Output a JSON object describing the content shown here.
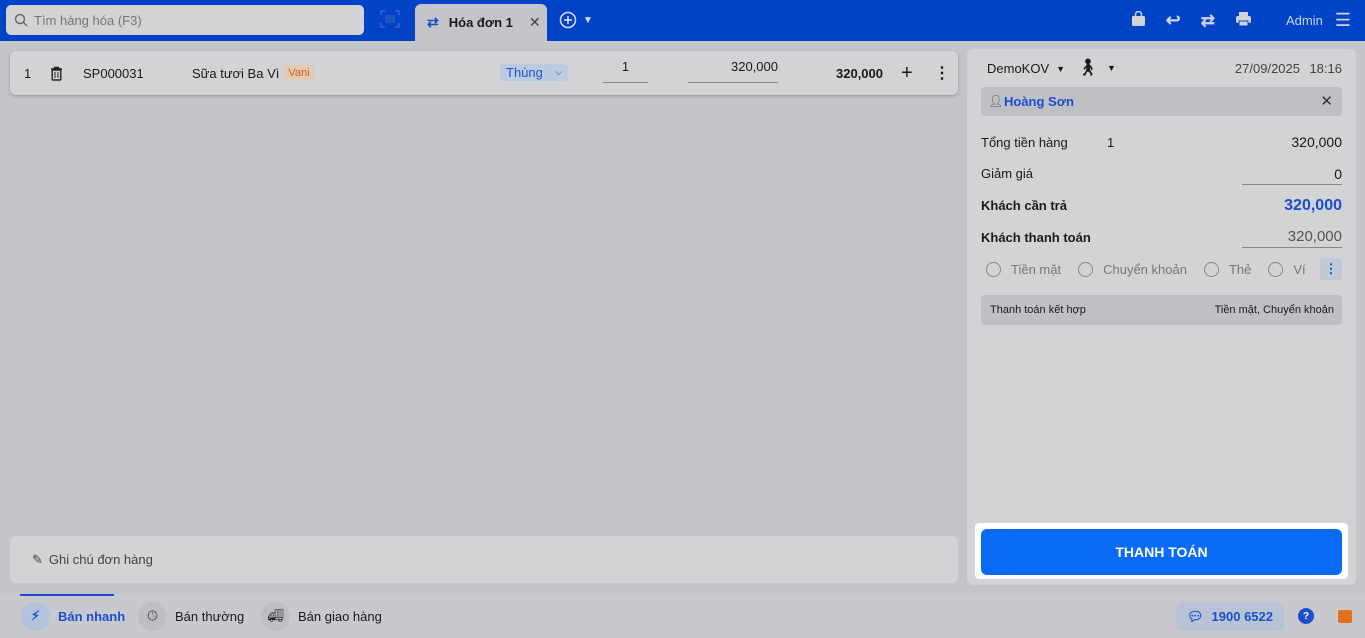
{
  "header": {
    "search_placeholder": "Tìm hàng hóa (F3)",
    "tab_label": "Hóa đơn 1",
    "user": "Admin"
  },
  "line": {
    "index": "1",
    "code": "SP000031",
    "name": "Sữa tươi Ba Vì",
    "variant": "Vani",
    "unit": "Thùng",
    "quantity": "1",
    "price": "320,000",
    "total": "320,000"
  },
  "note_placeholder": "Ghi chú đơn hàng",
  "summary": {
    "branch": "DemoKOV",
    "date": "27/09/2025",
    "time": "18:16",
    "customer": "Hoàng Sơn",
    "total_label": "Tổng tiền hàng",
    "total_count": "1",
    "total_value": "320,000",
    "discount_label": "Giảm giá",
    "discount_value": "0",
    "due_label": "Khách cần trả",
    "due_value": "320,000",
    "paid_label": "Khách thanh toán",
    "paid_value": "320,000",
    "methods": [
      "Tiền mặt",
      "Chuyển khoản",
      "Thẻ",
      "Ví"
    ],
    "combo_label": "Thanh toán kết hợp",
    "combo_value": "Tiền mặt, Chuyển khoản",
    "pay_button": "THANH TOÁN"
  },
  "footer": {
    "modes": [
      "Bán nhanh",
      "Bán thường",
      "Bán giao hàng"
    ],
    "hotline": "1900 6522"
  }
}
